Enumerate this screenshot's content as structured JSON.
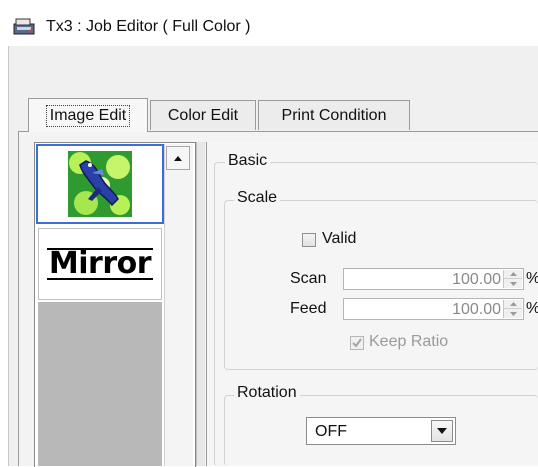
{
  "window": {
    "title": "Tx3 : Job Editor ( Full Color )",
    "icon": "scanner-app-icon"
  },
  "tabs": [
    {
      "label": "Image Edit",
      "active": true
    },
    {
      "label": "Color Edit",
      "active": false
    },
    {
      "label": "Print Condition",
      "active": false
    }
  ],
  "image_list": {
    "items": [
      {
        "kind": "thumbnail",
        "selected": true
      },
      {
        "kind": "mirror-label",
        "text": "Mirror",
        "selected": false
      }
    ]
  },
  "basic": {
    "title": "Basic",
    "scale": {
      "title": "Scale",
      "valid_label": "Valid",
      "valid_checked": false,
      "scan_label": "Scan",
      "scan_value": "100.00",
      "feed_label": "Feed",
      "feed_value": "100.00",
      "unit": "%",
      "keep_ratio_label": "Keep Ratio",
      "keep_ratio_checked": true,
      "keep_ratio_enabled": false
    },
    "rotation": {
      "title": "Rotation",
      "value": "OFF"
    }
  },
  "colors": {
    "selection_border": "#3b6fd6",
    "thumbnail_green": "#33cc33",
    "list_background": "#b8b8b8"
  }
}
